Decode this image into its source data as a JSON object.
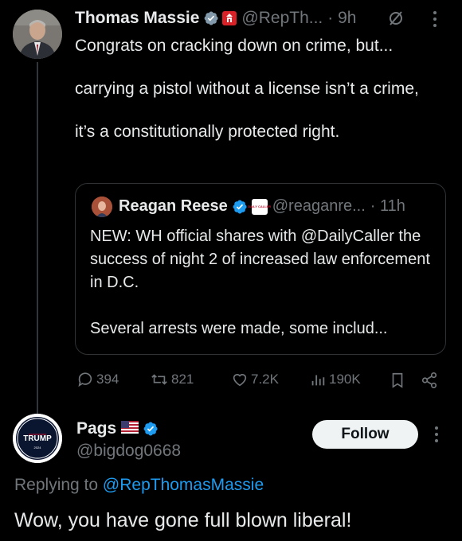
{
  "original_tweet": {
    "author_name": "Thomas Massie",
    "handle": "@RepTh...",
    "time": "· 9h",
    "paragraphs": [
      "Congrats on cracking down on crime, but...",
      "carrying a pistol without a license isn’t a crime,",
      "it’s a constitutionally protected right."
    ]
  },
  "quoted_tweet": {
    "author_name": "Reagan Reese",
    "handle": "@reaganre...",
    "time": "· 11h",
    "affiliation_badge_text": "DAILY CALLER",
    "paragraphs": [
      "NEW: WH official shares with @DailyCaller the success of night 2 of increased law enforcement in D.C.",
      "Several arrests were made, some includ..."
    ]
  },
  "actions": {
    "replies": "394",
    "reposts": "821",
    "likes": "7.2K",
    "views": "190K"
  },
  "reply": {
    "author_name": "Pags",
    "flag": "🇺🇸",
    "handle": "@bigdog0668",
    "follow_label": "Follow",
    "replying_prefix": "Replying to",
    "replying_handle": "@RepThomasMassie",
    "text": "Wow, you have gone full blown liberal!",
    "avatar_text": "TRUMP",
    "avatar_subtext": "2024"
  },
  "colors": {
    "background": "#000000",
    "text": "#e7e9ea",
    "muted": "#71767b",
    "accent": "#1d9bf0",
    "border": "#2f3336"
  },
  "icons": [
    "verified-badge-icon",
    "government-badge-icon",
    "grok-icon",
    "more-icon",
    "reply-icon",
    "repost-icon",
    "like-icon",
    "views-icon",
    "bookmark-icon",
    "share-icon"
  ]
}
